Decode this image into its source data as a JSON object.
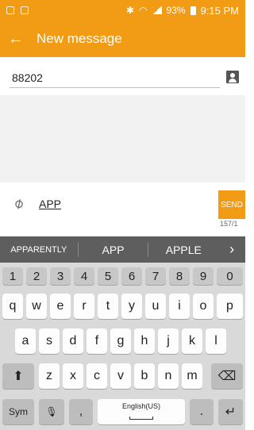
{
  "status_bar": {
    "battery": "93%",
    "time": "9:15 PM",
    "icons": [
      "voicemail-icon",
      "gallery-icon",
      "bluetooth-icon",
      "wifi-icon",
      "signal-icon",
      "battery-icon"
    ]
  },
  "app_bar": {
    "back_icon": "back-arrow-icon",
    "back_glyph": "←",
    "title": "New message"
  },
  "recipient": {
    "value": "88202",
    "contact_icon": "contact-icon"
  },
  "compose": {
    "attach_glyph": "⌀",
    "text": "APP",
    "send_label": "SEND",
    "counter": "157/1"
  },
  "keyboard": {
    "suggestions": [
      "APPARENTLY",
      "APP",
      "APPLE"
    ],
    "more_glyph": "›",
    "number_row": [
      "1",
      "2",
      "3",
      "4",
      "5",
      "6",
      "7",
      "8",
      "9",
      "0"
    ],
    "row1": [
      "q",
      "w",
      "e",
      "r",
      "t",
      "y",
      "u",
      "i",
      "o",
      "p"
    ],
    "row2": [
      "a",
      "s",
      "d",
      "f",
      "g",
      "h",
      "j",
      "k",
      "l"
    ],
    "row3": [
      "z",
      "x",
      "c",
      "v",
      "b",
      "n",
      "m"
    ],
    "shift_glyph": "⬆",
    "backspace_glyph": "⌫",
    "sym_label": "Sym",
    "mic_glyph": "🎙",
    "comma_label": ",",
    "space_label": "English(US)",
    "period_label": ".",
    "enter_glyph": "↵"
  },
  "colors": {
    "accent": "#f29b14",
    "suggestion_bar": "#5e5e5e",
    "keyboard_bg": "#d9d9d9"
  }
}
